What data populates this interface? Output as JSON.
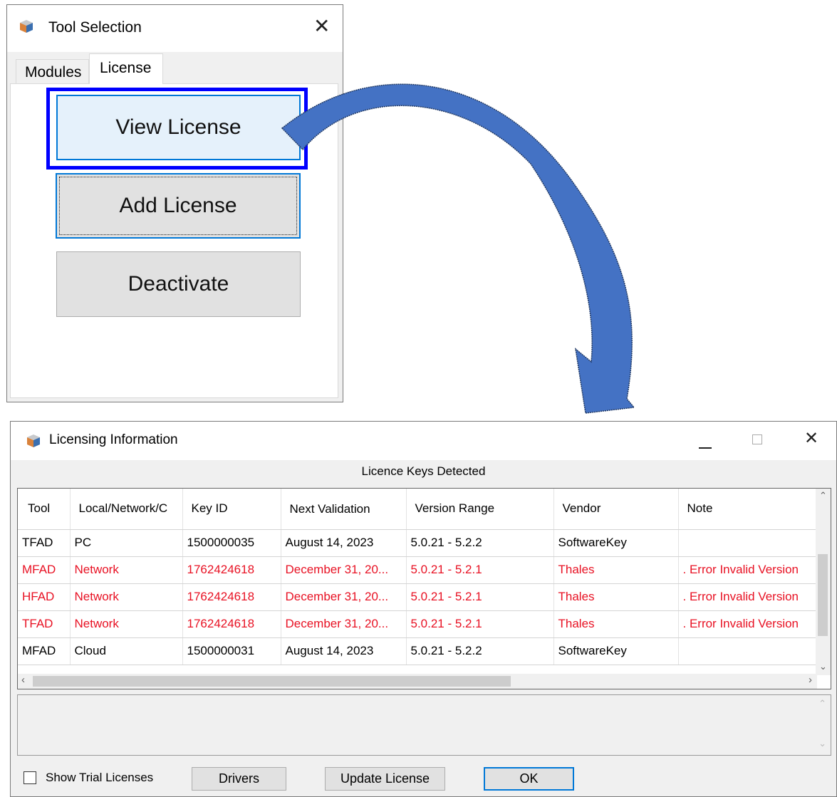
{
  "tool_window": {
    "title": "Tool Selection",
    "tabs": [
      "Modules",
      "License"
    ],
    "active_tab": "License",
    "buttons": {
      "view_license": "View License",
      "add_license": "Add License",
      "deactivate": "Deactivate"
    }
  },
  "license_window": {
    "title": "Licensing Information",
    "caption": "Licence Keys Detected",
    "columns": [
      "Tool",
      "Local/Network/C",
      "Key ID",
      "Next Validation",
      "Version Range",
      "Vendor",
      "Note"
    ],
    "rows": [
      {
        "tool": "TFAD",
        "type": "PC",
        "key_id": "1500000035",
        "next_validation": "August 14, 2023",
        "version_range": "5.0.21 - 5.2.2",
        "vendor": "SoftwareKey",
        "note": "",
        "error": false
      },
      {
        "tool": "MFAD",
        "type": "Network",
        "key_id": "1762424618",
        "next_validation": "December 31, 20...",
        "version_range": "5.0.21 - 5.2.1",
        "vendor": "Thales",
        "note": ". Error Invalid Version",
        "error": true
      },
      {
        "tool": "HFAD",
        "type": "Network",
        "key_id": "1762424618",
        "next_validation": "December 31, 20...",
        "version_range": "5.0.21 - 5.2.1",
        "vendor": "Thales",
        "note": ". Error Invalid Version",
        "error": true
      },
      {
        "tool": "TFAD",
        "type": "Network",
        "key_id": "1762424618",
        "next_validation": "December 31, 20...",
        "version_range": "5.0.21 - 5.2.1",
        "vendor": "Thales",
        "note": ". Error Invalid Version",
        "error": true
      },
      {
        "tool": "MFAD",
        "type": "Cloud",
        "key_id": "1500000031",
        "next_validation": "August 14, 2023",
        "version_range": "5.0.21 - 5.2.2",
        "vendor": "SoftwareKey",
        "note": "",
        "error": false
      }
    ],
    "show_trial_label": "Show Trial Licenses",
    "show_trial_checked": false,
    "buttons": {
      "drivers": "Drivers",
      "update_license": "Update License",
      "ok": "OK"
    }
  },
  "colors": {
    "error_text": "#e81123",
    "arrow_fill": "#4472c4",
    "arrow_stroke": "#1f3864",
    "highlight_border": "#0000ff",
    "focus_border": "#0078d7"
  },
  "icons": [
    "app-cube-icon",
    "close-icon",
    "minimize-icon",
    "maximize-icon",
    "scroll-up-icon",
    "scroll-down-icon",
    "scroll-left-icon",
    "scroll-right-icon",
    "curved-arrow-icon"
  ]
}
